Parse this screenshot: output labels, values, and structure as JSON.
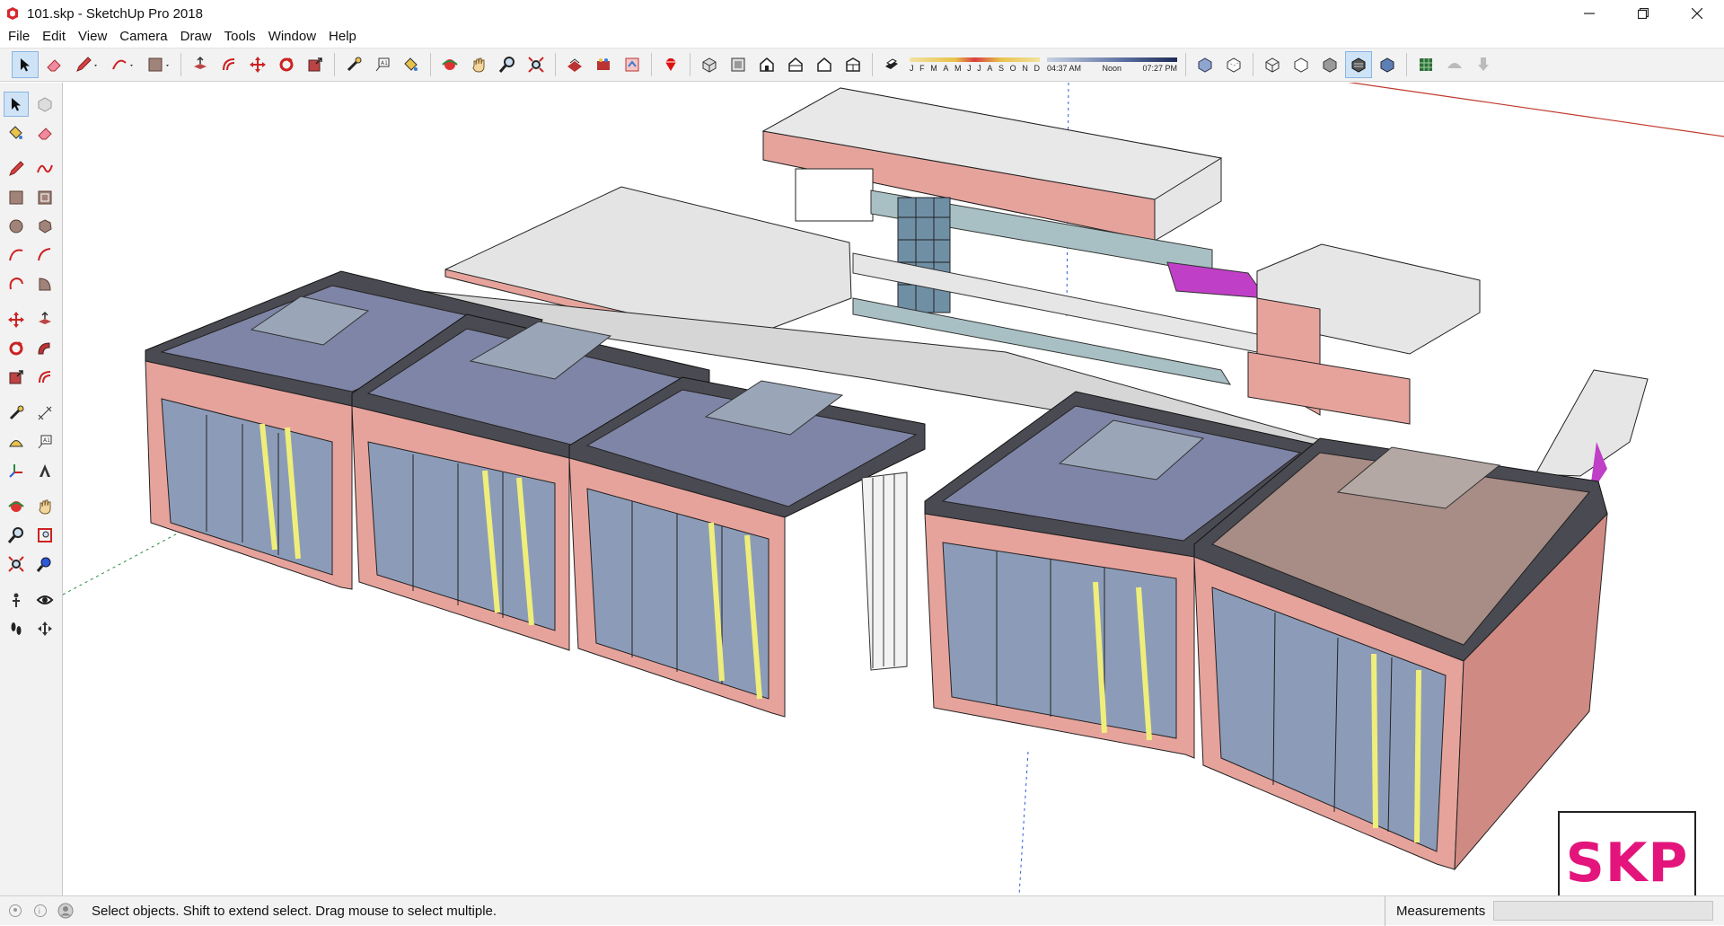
{
  "window": {
    "title": "101.skp - SketchUp Pro 2018",
    "icons": {
      "app": "sketchup-icon",
      "minimize": "minimize-icon",
      "restore": "restore-icon",
      "close": "close-icon"
    }
  },
  "menu": [
    "File",
    "Edit",
    "View",
    "Camera",
    "Draw",
    "Tools",
    "Window",
    "Help"
  ],
  "toolbar": {
    "tools": [
      "select-icon",
      "eraser-icon",
      "pencil-icon",
      "arc-icon",
      "rectangle-icon",
      "push-pull-icon",
      "offset-icon",
      "move-icon",
      "rotate-icon",
      "scale-icon",
      "tape-measure-icon",
      "text-icon",
      "paint-bucket-icon",
      "orbit-icon",
      "pan-icon",
      "zoom-icon",
      "zoom-extents-icon",
      "warehouse-icon",
      "extension-warehouse-icon",
      "layout-icon",
      "ruby-icon",
      "iso-view-icon",
      "top-view-icon",
      "front-view-icon",
      "right-view-icon",
      "back-view-icon",
      "left-view-icon",
      "shadows-icon",
      "xray-icon",
      "back-edges-icon",
      "wireframe-icon",
      "hidden-line-icon",
      "shaded-icon",
      "shaded-textures-icon",
      "monochrome-icon",
      "sandbox-icon",
      "smoove-icon",
      "stamp-icon"
    ],
    "months": [
      "J",
      "F",
      "M",
      "A",
      "M",
      "J",
      "J",
      "A",
      "S",
      "O",
      "N",
      "D"
    ],
    "times": [
      "04:37 AM",
      "Noon",
      "07:27 PM"
    ]
  },
  "palette": [
    "select-icon",
    "component-icon",
    "paint-bucket-icon",
    "eraser-icon",
    "line-icon",
    "freehand-icon",
    "rectangle-icon",
    "rotated-rectangle-icon",
    "circle-icon",
    "polygon-icon",
    "arc-icon",
    "two-point-arc-icon",
    "three-point-arc-icon",
    "pie-icon",
    "move-icon",
    "push-pull-icon",
    "rotate-icon",
    "follow-me-icon",
    "scale-icon",
    "offset-icon",
    "tape-measure-icon",
    "dimension-icon",
    "protractor-icon",
    "text-icon",
    "axes-icon",
    "3d-text-icon",
    "orbit-icon",
    "pan-icon",
    "zoom-icon",
    "zoom-window-icon",
    "zoom-extents-icon",
    "previous-view-icon",
    "position-camera-icon",
    "look-around-icon",
    "walk-icon",
    "section-plane-icon"
  ],
  "status": {
    "message": "Select objects. Shift to extend select. Drag mouse to select multiple.",
    "measurements_label": "Measurements",
    "icons": [
      "geo-location-icon",
      "credit-icon",
      "user-account-icon"
    ]
  },
  "badge": {
    "logo_text": "SKP"
  },
  "colors": {
    "brick": "#e6a39c",
    "roof": "#7f85a6",
    "glass": "#8c9cb8",
    "accent": "#e3157c"
  }
}
